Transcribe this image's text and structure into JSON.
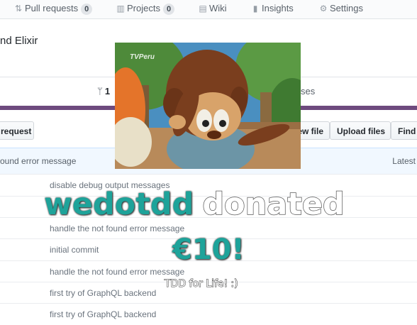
{
  "nav": {
    "pull_requests": {
      "label": "Pull requests",
      "count": "0",
      "icon": "git-pull-request-icon"
    },
    "projects": {
      "label": "Projects",
      "count": "0",
      "icon": "project-icon"
    },
    "wiki": {
      "label": "Wiki",
      "icon": "book-icon"
    },
    "insights": {
      "label": "Insights",
      "icon": "graph-icon"
    },
    "settings": {
      "label": "Settings",
      "icon": "gear-icon"
    }
  },
  "repo": {
    "description": "nd Elixir"
  },
  "summary": {
    "branches_label": "1",
    "releases_label": "ses"
  },
  "toolbar": {
    "new_pull_request": "request",
    "create_new_file": "ew file",
    "upload_files": "Upload files",
    "find_file": "Find"
  },
  "latest_commit": {
    "message": "ound error message",
    "latest_label": "Latest"
  },
  "files": [
    {
      "message": "disable debug output messages"
    },
    {
      "message": ""
    },
    {
      "message": "handle the not found error message"
    },
    {
      "message": "initial commit"
    },
    {
      "message": "handle the not found error message"
    },
    {
      "message": "first try of GraphQL backend"
    },
    {
      "message": "first try of GraphQL backend"
    }
  ],
  "overlay": {
    "gif_watermark": "TVPeru",
    "donor": "wedotdd",
    "action": "donated",
    "amount": "€10!",
    "message": "TDD for Life! :)"
  },
  "colors": {
    "donor_teal": "#1ea39a",
    "lang_bar": "#6e4a7e",
    "commit_header_bg": "#f1f8ff"
  }
}
